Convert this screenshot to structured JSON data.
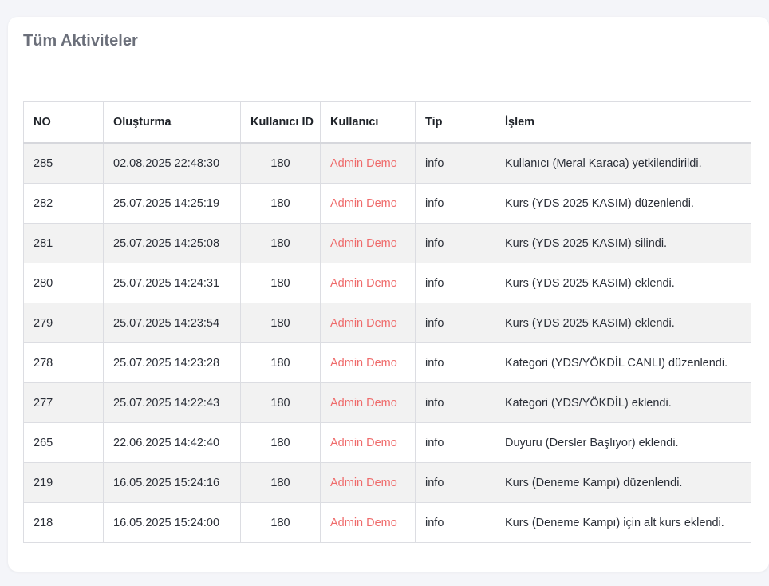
{
  "page": {
    "title": "Tüm Aktiviteler"
  },
  "table": {
    "columns": [
      "NO",
      "Oluşturma",
      "Kullanıcı ID",
      "Kullanıcı",
      "Tip",
      "İşlem"
    ],
    "rows": [
      {
        "no": "285",
        "created": "02.08.2025 22:48:30",
        "user_id": "180",
        "user": "Admin Demo",
        "type": "info",
        "action": "Kullanıcı (Meral Karaca) yetkilendirildi."
      },
      {
        "no": "282",
        "created": "25.07.2025 14:25:19",
        "user_id": "180",
        "user": "Admin Demo",
        "type": "info",
        "action": "Kurs (YDS 2025 KASIM) düzenlendi."
      },
      {
        "no": "281",
        "created": "25.07.2025 14:25:08",
        "user_id": "180",
        "user": "Admin Demo",
        "type": "info",
        "action": "Kurs (YDS 2025 KASIM) silindi."
      },
      {
        "no": "280",
        "created": "25.07.2025 14:24:31",
        "user_id": "180",
        "user": "Admin Demo",
        "type": "info",
        "action": "Kurs (YDS 2025 KASIM) eklendi."
      },
      {
        "no": "279",
        "created": "25.07.2025 14:23:54",
        "user_id": "180",
        "user": "Admin Demo",
        "type": "info",
        "action": "Kurs (YDS 2025 KASIM) eklendi."
      },
      {
        "no": "278",
        "created": "25.07.2025 14:23:28",
        "user_id": "180",
        "user": "Admin Demo",
        "type": "info",
        "action": "Kategori (YDS/YÖKDİL CANLI) düzenlendi."
      },
      {
        "no": "277",
        "created": "25.07.2025 14:22:43",
        "user_id": "180",
        "user": "Admin Demo",
        "type": "info",
        "action": "Kategori (YDS/YÖKDİL) eklendi."
      },
      {
        "no": "265",
        "created": "22.06.2025 14:42:40",
        "user_id": "180",
        "user": "Admin Demo",
        "type": "info",
        "action": "Duyuru (Dersler Başlıyor) eklendi."
      },
      {
        "no": "219",
        "created": "16.05.2025 15:24:16",
        "user_id": "180",
        "user": "Admin Demo",
        "type": "info",
        "action": "Kurs (Deneme Kampı) düzenlendi."
      },
      {
        "no": "218",
        "created": "16.05.2025 15:24:00",
        "user_id": "180",
        "user": "Admin Demo",
        "type": "info",
        "action": "Kurs (Deneme Kampı) için alt kurs eklendi."
      }
    ]
  },
  "colors": {
    "user_link": "#ef6b6b",
    "row_stripe": "#f2f2f2",
    "page_background": "#f4f5f9"
  }
}
